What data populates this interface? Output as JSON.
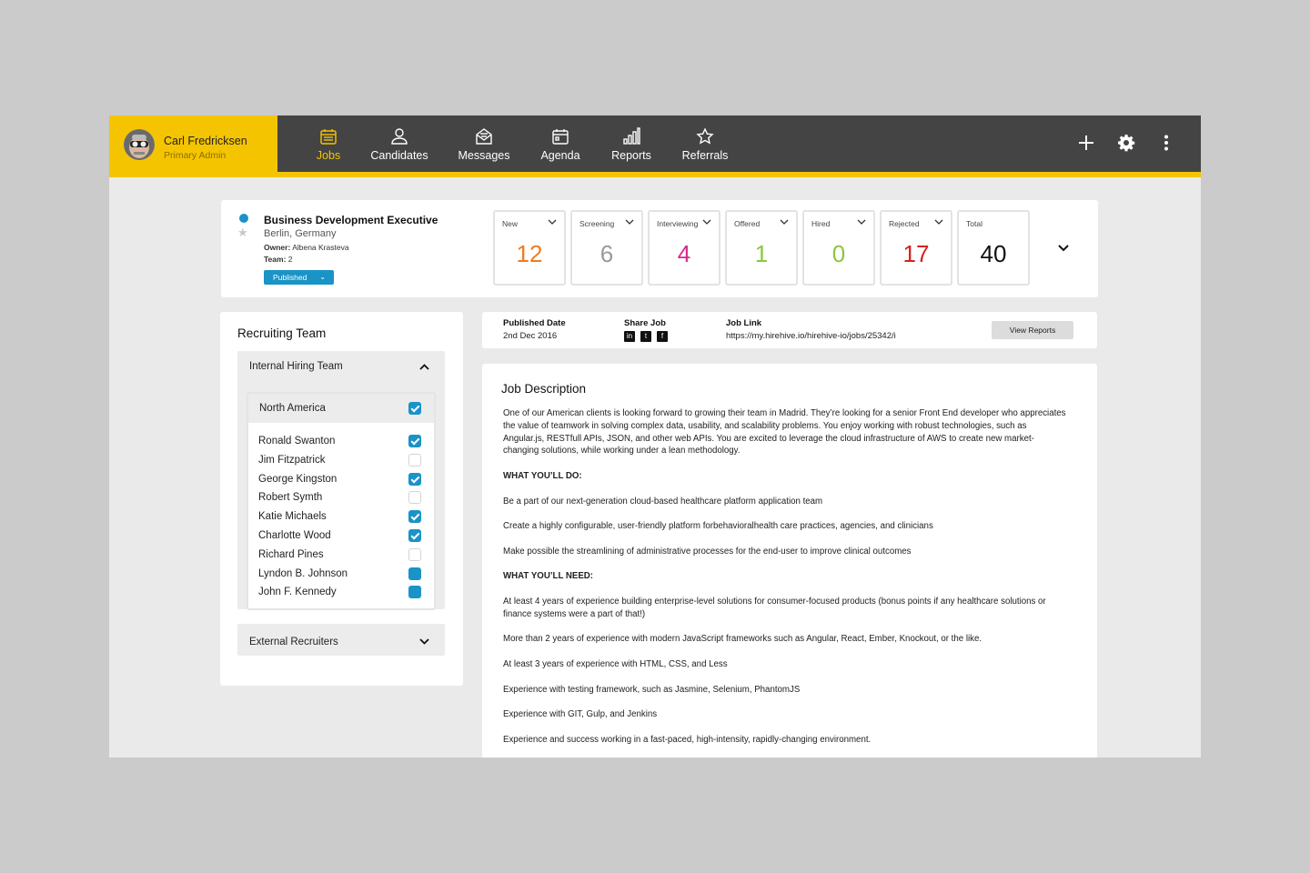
{
  "user": {
    "name": "Carl Fredricksen",
    "role": "Primary Admin"
  },
  "nav": [
    {
      "label": "Jobs",
      "icon": "briefcase-icon",
      "active": true
    },
    {
      "label": "Candidates",
      "icon": "person-icon",
      "active": false
    },
    {
      "label": "Messages",
      "icon": "envelope-icon",
      "active": false
    },
    {
      "label": "Agenda",
      "icon": "calendar-icon",
      "active": false
    },
    {
      "label": "Reports",
      "icon": "bar-chart-icon",
      "active": false
    },
    {
      "label": "Referrals",
      "icon": "star-icon",
      "active": false
    }
  ],
  "actions": {
    "add": "plus-icon",
    "settings": "gear-icon",
    "more": "more-vertical-icon"
  },
  "job": {
    "title": "Business Development Executive",
    "location": "Berlin, Germany",
    "owner_label": "Owner:",
    "owner": "Albena Krasteva",
    "team_label": "Team:",
    "team": "2",
    "status": "Published"
  },
  "stages": [
    {
      "label": "New",
      "count": "12",
      "color": "#f07b1e"
    },
    {
      "label": "Screening",
      "count": "6",
      "color": "#9a9a9a"
    },
    {
      "label": "Interviewing",
      "count": "4",
      "color": "#d42a8f"
    },
    {
      "label": "Offered",
      "count": "1",
      "color": "#8cc63f"
    },
    {
      "label": "Hired",
      "count": "0",
      "color": "#8cc63f"
    },
    {
      "label": "Rejected",
      "count": "17",
      "color": "#d0241f"
    },
    {
      "label": "Total",
      "count": "40",
      "color": "#111111"
    }
  ],
  "team": {
    "title": "Recruiting Team",
    "internal_title": "Internal Hiring Team",
    "region": "North America",
    "people": [
      {
        "name": "Ronald Swanton",
        "state": "on"
      },
      {
        "name": "Jim Fitzpatrick",
        "state": "off"
      },
      {
        "name": "George Kingston",
        "state": "on"
      },
      {
        "name": "Robert Symth",
        "state": "off"
      },
      {
        "name": "Katie Michaels",
        "state": "on"
      },
      {
        "name": "Charlotte Wood",
        "state": "on"
      },
      {
        "name": "Richard Pines",
        "state": "off"
      },
      {
        "name": "Lyndon B. Johnson",
        "state": "fill"
      },
      {
        "name": "John F. Kennedy",
        "state": "fill"
      }
    ],
    "external_title": "External Recruiters"
  },
  "meta": {
    "published_label": "Published Date",
    "published_value": "2nd Dec 2016",
    "share_label": "Share Job",
    "link_label": "Job Link",
    "link_value": "https://my.hirehive.io/hirehive-io/jobs/25342/i",
    "view_reports": "View Reports"
  },
  "description": {
    "title": "Job Description",
    "paragraphs": [
      {
        "text": "One of our American clients is looking forward to growing their team in Madrid. They’re looking for a senior Front End developer who appreciates the value of teamwork in solving complex data, usability, and scalability problems. You enjoy working with robust technologies, such as Angular.js, RESTfull APIs, JSON, and other web APIs. You are excited to leverage the cloud infrastructure of AWS to create new market-changing solutions, while working under a lean methodology.",
        "heading": false
      },
      {
        "text": "WHAT YOU’LL DO:",
        "heading": true
      },
      {
        "text": "Be a part of our next-generation cloud-based healthcare platform application team",
        "heading": false
      },
      {
        "text": "Create a highly configurable, user-friendly platform forbehavioralhealth care practices, agencies, and clinicians",
        "heading": false
      },
      {
        "text": "Make possible the streamlining of administrative processes for the end-user to improve clinical outcomes",
        "heading": false
      },
      {
        "text": "WHAT YOU’LL NEED:",
        "heading": true
      },
      {
        "text": "At least 4 years of experience building enterprise-level solutions for consumer-focused products (bonus points if any healthcare solutions or finance systems were a part of that!)",
        "heading": false
      },
      {
        "text": "More than 2 years of experience with modern JavaScript frameworks such as Angular, React, Ember, Knockout, or the like.",
        "heading": false
      },
      {
        "text": "At least 3 years of experience with HTML, CSS, and Less",
        "heading": false
      },
      {
        "text": "Experience with testing framework, such as Jasmine, Selenium, PhantomJS",
        "heading": false
      },
      {
        "text": "Experience with GIT, Gulp, and Jenkins",
        "heading": false
      },
      {
        "text": "Experience and success working in a fast-paced, high-intensity, rapidly-changing environment.",
        "heading": false
      }
    ]
  }
}
